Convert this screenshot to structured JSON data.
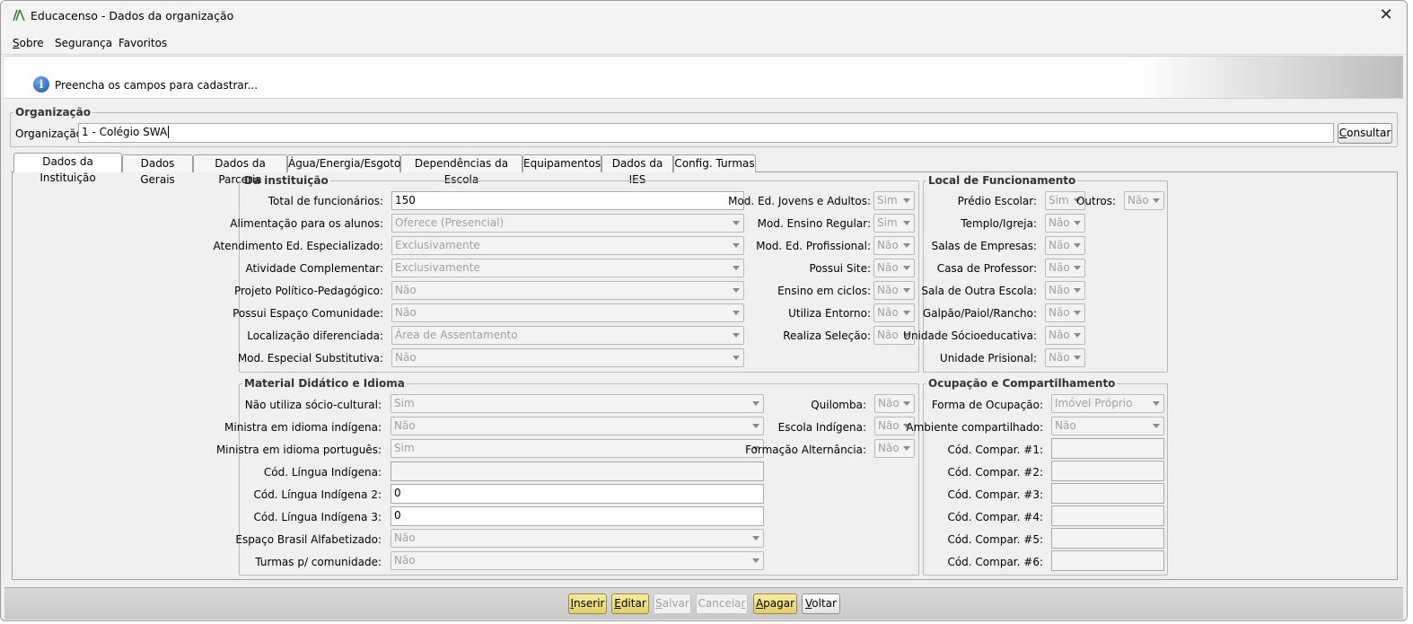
{
  "window": {
    "title": "Educacenso - Dados da organização",
    "close_label": "✕"
  },
  "menu": [
    {
      "key": "S",
      "rest": "obre"
    },
    {
      "label": "Segurança"
    },
    {
      "label": "Favoritos"
    }
  ],
  "hint": {
    "text": "Preencha os campos para cadastrar..."
  },
  "organizacao": {
    "legend": "Organização",
    "label": "Organização:",
    "value": "1 - Colégio SWA",
    "consultar_key": "C",
    "consultar_rest": "onsultar"
  },
  "tabs": [
    {
      "label": "Dados da Instituição",
      "active": true
    },
    {
      "label": "Dados Gerais"
    },
    {
      "label": "Dados da Parceria"
    },
    {
      "label": "Água/Energia/Esgoto"
    },
    {
      "label": "Dependências da Escola"
    },
    {
      "label": "Equipamentos"
    },
    {
      "label": "Dados da IES"
    },
    {
      "label": "Config. Turmas"
    }
  ],
  "da_instituicao": {
    "legend": "Da instituição",
    "left": [
      {
        "label": "Total de funcionários:",
        "value": "150",
        "type": "text"
      },
      {
        "label": "Alimentação para os alunos:",
        "value": "Oferece (Presencial)",
        "type": "combo"
      },
      {
        "label": "Atendimento Ed. Especializado:",
        "value": "Exclusivamente",
        "type": "combo"
      },
      {
        "label": "Atividade Complementar:",
        "value": "Exclusivamente",
        "type": "combo"
      },
      {
        "label": "Projeto Político-Pedagógico:",
        "value": "Não",
        "type": "combo"
      },
      {
        "label": "Possui Espaço Comunidade:",
        "value": "Não",
        "type": "combo"
      },
      {
        "label": "Localização diferenciada:",
        "value": "Área de Assentamento",
        "type": "combo"
      },
      {
        "label": "Mod. Especial Substitutiva:",
        "value": "Não",
        "type": "combo"
      }
    ],
    "right": [
      {
        "label": "Mod. Ed. Jovens e Adultos:",
        "value": "Sim"
      },
      {
        "label": "Mod. Ensino Regular:",
        "value": "Sim"
      },
      {
        "label": "Mod. Ed. Profissional:",
        "value": "Não"
      },
      {
        "label": "Possui Site:",
        "value": "Não"
      },
      {
        "label": "Ensino em ciclos:",
        "value": "Não"
      },
      {
        "label": "Utiliza Entorno:",
        "value": "Não"
      },
      {
        "label": "Realiza Seleção:",
        "value": "Não"
      }
    ]
  },
  "local_funcionamento": {
    "legend": "Local de Funcionamento",
    "items": [
      {
        "label": "Prédio Escolar:",
        "value": "Sim"
      },
      {
        "label": "Templo/Igreja:",
        "value": "Não"
      },
      {
        "label": "Salas de Empresas:",
        "value": "Não"
      },
      {
        "label": "Casa de Professor:",
        "value": "Não"
      },
      {
        "label": "Sala de Outra Escola:",
        "value": "Não"
      },
      {
        "label": "Galpão/Paiol/Rancho:",
        "value": "Não"
      },
      {
        "label": "Unidade Sócioeducativa:",
        "value": "Não"
      },
      {
        "label": "Unidade Prisional:",
        "value": "Não"
      }
    ],
    "outros": {
      "label": "Outros:",
      "value": "Não"
    }
  },
  "material": {
    "legend": "Material Didático e Idioma",
    "left": [
      {
        "label": "Não utiliza sócio-cultural:",
        "value": "Sim",
        "type": "combo"
      },
      {
        "label": "Ministra em idioma indígena:",
        "value": "Não",
        "type": "combo"
      },
      {
        "label": "Ministra em idioma português:",
        "value": "Sim",
        "type": "combo"
      },
      {
        "label": "Cód. Língua Indígena:",
        "value": "",
        "type": "ro"
      },
      {
        "label": "Cód. Língua Indígena 2:",
        "value": "0",
        "type": "text"
      },
      {
        "label": "Cód. Língua Indígena 3:",
        "value": "0",
        "type": "text"
      },
      {
        "label": "Espaço Brasil Alfabetizado:",
        "value": "Não",
        "type": "combo"
      },
      {
        "label": "Turmas p/ comunidade:",
        "value": "Não",
        "type": "combo"
      }
    ],
    "right": [
      {
        "label": "Quilomba:",
        "value": "Não"
      },
      {
        "label": "Escola Indígena:",
        "value": "Não"
      },
      {
        "label": "Formação Alternância:",
        "value": "Não"
      }
    ]
  },
  "ocupacao": {
    "legend": "Ocupação e Compartilhamento",
    "forma_label": "Forma de Ocupação:",
    "forma_value": "Imóvel Próprio",
    "ambiente_label": "Ambiente compartilhado:",
    "ambiente_value": "Não",
    "codigos": [
      "Cód. Compar. #1:",
      "Cód. Compar. #2:",
      "Cód. Compar. #3:",
      "Cód. Compar. #4:",
      "Cód. Compar. #5:",
      "Cód. Compar. #6:"
    ]
  },
  "buttons": {
    "inserir_key": "I",
    "inserir_rest": "nserir",
    "editar_key": "E",
    "editar_rest": "ditar",
    "salvar_key": "S",
    "salvar_rest": "alvar",
    "cancelar_pre": "Cancela",
    "cancelar_key": "r",
    "apagar_key": "A",
    "apagar_rest": "pagar",
    "voltar_key": "V",
    "voltar_rest": "oltar"
  },
  "colors": {
    "highlight_button": "#e9d77c",
    "info_icon": "#1e56b0"
  }
}
